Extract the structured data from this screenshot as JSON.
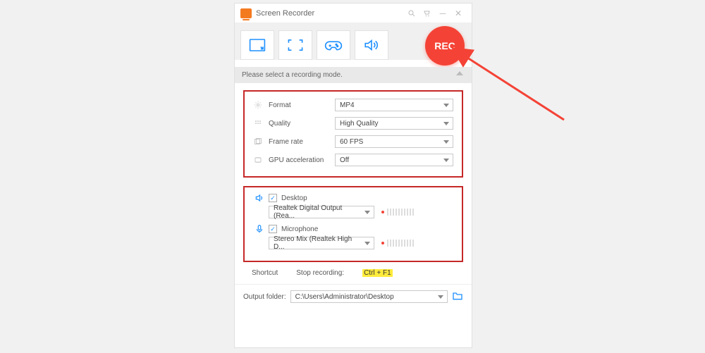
{
  "titlebar": {
    "title": "Screen Recorder"
  },
  "rec": {
    "label": "REC"
  },
  "subbar": {
    "text": "Please select a recording mode."
  },
  "settings": {
    "format": {
      "label": "Format",
      "value": "MP4"
    },
    "quality": {
      "label": "Quality",
      "value": "High Quality"
    },
    "framerate": {
      "label": "Frame rate",
      "value": "60 FPS"
    },
    "gpu": {
      "label": "GPU acceleration",
      "value": "Off"
    }
  },
  "audio": {
    "desktop": {
      "label": "Desktop",
      "device": "Realtek Digital Output (Rea..."
    },
    "mic": {
      "label": "Microphone",
      "device": "Stereo Mix (Realtek High D..."
    }
  },
  "shortcut": {
    "label": "Shortcut",
    "stop_label": "Stop recording:",
    "keys": "Ctrl + F1"
  },
  "footer": {
    "label": "Output folder:",
    "path": "C:\\Users\\Administrator\\Desktop"
  }
}
